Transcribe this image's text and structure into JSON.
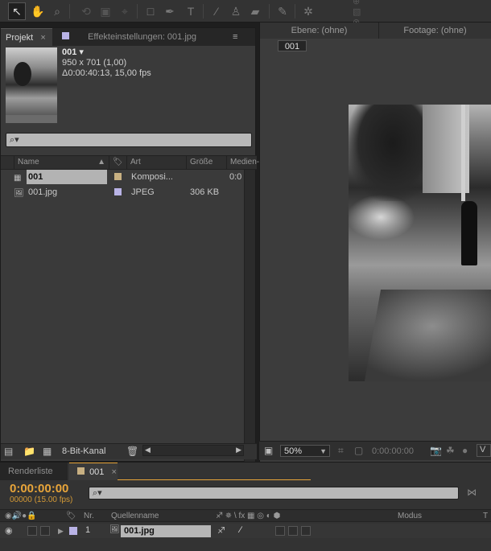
{
  "toolbar": {
    "tools": [
      "selection-tool",
      "hand-tool",
      "zoom-tool",
      "rotate-tool",
      "camera-tool",
      "pan-behind-tool",
      "rectangle-tool",
      "pen-tool",
      "type-tool",
      "brush-tool",
      "clone-stamp-tool",
      "eraser-tool",
      "roto-brush-tool",
      "puppet-pin-tool"
    ],
    "active_tool": "selection-tool"
  },
  "project_panel": {
    "tab_label": "Projekt",
    "tab2_label": "Effekteinstellungen: 001.jpg",
    "item_name": "001 ▾",
    "item_size": "950 x 701 (1,00)",
    "item_duration": "Δ0:00:40:13, 15,00 fps",
    "search_placeholder": "⌕▾",
    "columns": [
      "Name",
      "Art",
      "Größe",
      "Medien-"
    ],
    "rows": [
      {
        "name": "001",
        "type": "Komposi...",
        "size": "",
        "media": "0:0",
        "swatch": "#c8b082"
      },
      {
        "name": "001.jpg",
        "type": "JPEG",
        "size": "306 KB",
        "media": "",
        "swatch": "#b9b3e6"
      }
    ],
    "footer_label": "8-Bit-Kanal"
  },
  "viewer_panel": {
    "tab_layer": "Ebene: (ohne)",
    "tab_footage": "Footage: (ohne)",
    "comp_button": "001",
    "zoom": "50%",
    "timecode": "0:00:00:00"
  },
  "timeline_panel": {
    "tab_render": "Renderliste",
    "tab_comp": "001",
    "current_time": "0:00:00:00",
    "frame_info": "00000 (15.00 fps)",
    "search_placeholder": "⌕▾",
    "columns": {
      "nr": "Nr.",
      "source": "Quellenname",
      "mode": "Modus",
      "t": "T"
    },
    "layer": {
      "number": "1",
      "name": "001.jpg"
    }
  }
}
